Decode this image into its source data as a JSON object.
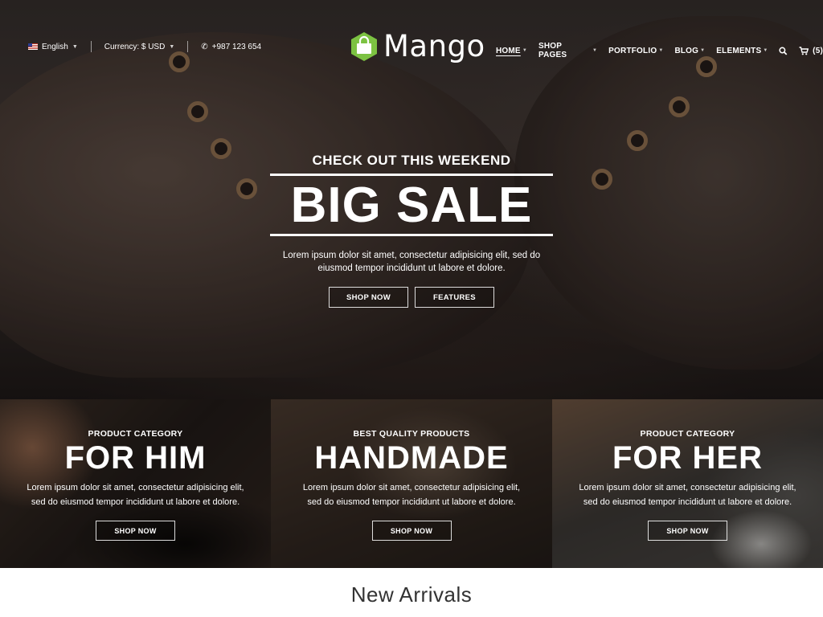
{
  "topbar": {
    "language": "English",
    "currency": "Currency: $ USD",
    "phone": "+987 123 654"
  },
  "logo": {
    "text": "Mango",
    "mark_color": "#7cc242"
  },
  "nav": {
    "items": [
      {
        "label": "HOME",
        "active": true
      },
      {
        "label": "SHOP PAGES"
      },
      {
        "label": "PORTFOLIO"
      },
      {
        "label": "BLOG"
      },
      {
        "label": "ELEMENTS"
      }
    ],
    "cart_count": "(5)"
  },
  "hero": {
    "kicker": "CHECK OUT THIS WEEKEND",
    "headline": "BIG SALE",
    "description": "Lorem ipsum dolor sit amet, consectetur adipisicing elit, sed do eiusmod tempor incididunt ut labore et dolore.",
    "primary_button": "SHOP NOW",
    "secondary_button": "FEATURES"
  },
  "categories": [
    {
      "kicker": "PRODUCT CATEGORY",
      "title": "FOR HIM",
      "description_line1": "Lorem ipsum dolor sit amet, consectetur adipisicing elit,",
      "description_line2": "sed do eiusmod tempor incididunt ut labore et dolore.",
      "button": "SHOP NOW"
    },
    {
      "kicker": "BEST QUALITY PRODUCTS",
      "title": "HANDMADE",
      "description_line1": "Lorem ipsum dolor sit amet, consectetur adipisicing elit,",
      "description_line2": "sed do eiusmod tempor incididunt ut labore et dolore.",
      "button": "SHOP NOW"
    },
    {
      "kicker": "PRODUCT CATEGORY",
      "title": "FOR HER",
      "description_line1": "Lorem ipsum dolor sit amet, consectetur adipisicing elit,",
      "description_line2": "sed do eiusmod tempor incididunt ut labore et dolore.",
      "button": "SHOP NOW"
    }
  ],
  "section": {
    "title": "New Arrivals"
  },
  "icons": {
    "flag": "us-flag-icon",
    "phone": "phone-icon",
    "search": "search-icon",
    "cart": "cart-icon",
    "logo": "shopping-bag-icon"
  }
}
